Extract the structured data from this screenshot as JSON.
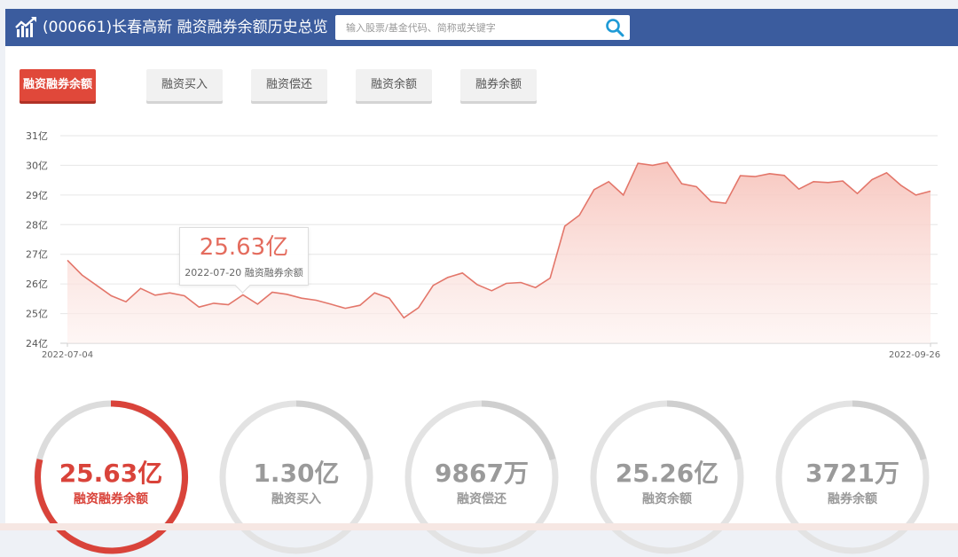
{
  "header": {
    "title": "(000661)长春高新 融资融券余额历史总览",
    "search_placeholder": "输入股票/基金代码、简称或关键字"
  },
  "tabs": [
    {
      "label": "融资融券余额",
      "active": true
    },
    {
      "label": "融资买入",
      "active": false
    },
    {
      "label": "融资偿还",
      "active": false
    },
    {
      "label": "融资余额",
      "active": false
    },
    {
      "label": "融券余额",
      "active": false
    }
  ],
  "chart_data": {
    "type": "area",
    "x_start_label": "2022-07-04",
    "x_end_label": "2022-09-26",
    "yticks": [
      "24亿",
      "25亿",
      "26亿",
      "27亿",
      "28亿",
      "29亿",
      "30亿",
      "31亿"
    ],
    "ylim": [
      24,
      31
    ],
    "grid": true,
    "values": [
      26.8,
      26.3,
      25.95,
      25.6,
      25.4,
      25.85,
      25.62,
      25.7,
      25.6,
      25.22,
      25.35,
      25.3,
      25.63,
      25.32,
      25.72,
      25.65,
      25.52,
      25.45,
      25.32,
      25.18,
      25.28,
      25.7,
      25.52,
      24.86,
      25.2,
      25.95,
      26.22,
      26.37,
      25.98,
      25.77,
      26.02,
      26.05,
      25.88,
      26.2,
      27.95,
      28.32,
      29.18,
      29.45,
      29.0,
      30.07,
      30.0,
      30.1,
      29.38,
      29.28,
      28.78,
      28.72,
      29.65,
      29.62,
      29.72,
      29.66,
      29.2,
      29.45,
      29.42,
      29.47,
      29.05,
      29.52,
      29.75,
      29.32,
      29.0,
      29.13
    ],
    "line_color": "#e3766a",
    "fill_color": "#f9d3cd",
    "tooltip": {
      "value": "25.63亿",
      "date": "2022-07-20",
      "series": "融资融券余额"
    }
  },
  "rings": [
    {
      "value": "25.63亿",
      "label": "融资融券余额",
      "active": true
    },
    {
      "value": "1.30亿",
      "label": "融资买入",
      "active": false
    },
    {
      "value": "9867万",
      "label": "融资偿还",
      "active": false
    },
    {
      "value": "25.26亿",
      "label": "融资余额",
      "active": false
    },
    {
      "value": "3721万",
      "label": "融券余额",
      "active": false
    }
  ],
  "colors": {
    "header": "#3b5c9e",
    "accent": "#e0483a",
    "ring_inactive": "#dcdcdc"
  }
}
